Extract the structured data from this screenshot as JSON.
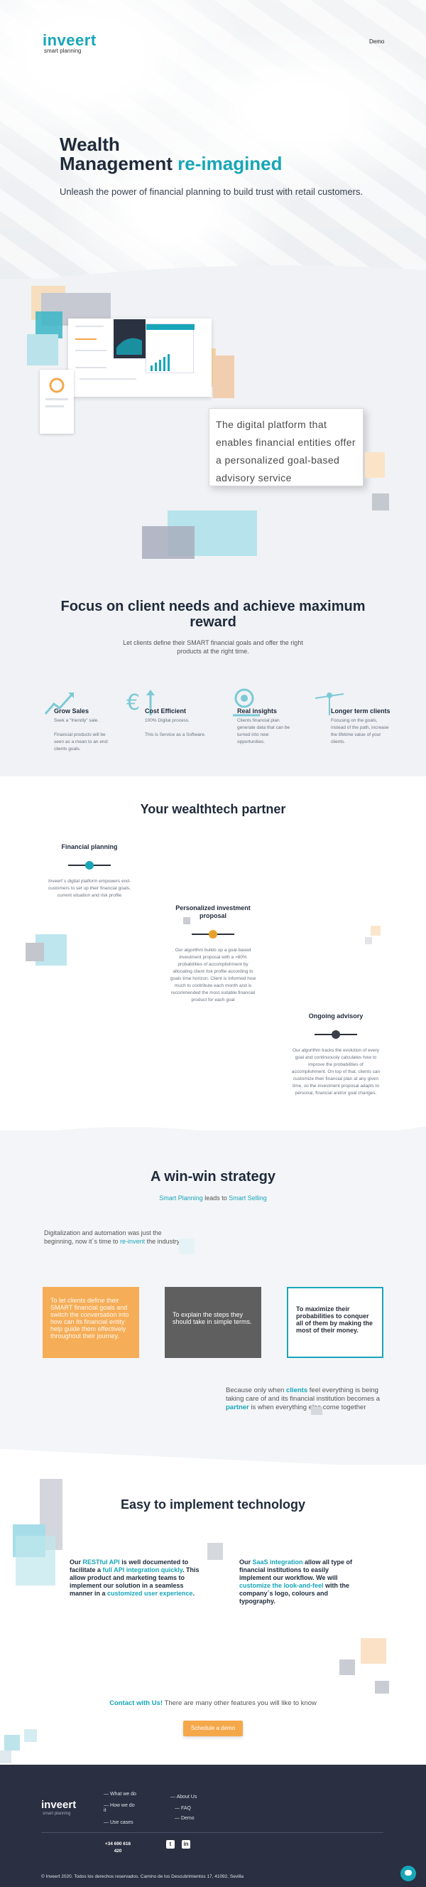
{
  "header": {
    "logo_word": "inveert",
    "logo_sub": "smart planning",
    "nav_demo": "Demo"
  },
  "hero": {
    "title_line1": "Wealth",
    "title_line2_a": "Management ",
    "title_line2_b": "re-imagined",
    "subtitle": "Unleash the power of financial planning to build trust with retail customers."
  },
  "platform": {
    "quote": "The digital platform that enables financial entities offer a personalized goal-based advisory service"
  },
  "focus": {
    "title": "Focus on client needs and achieve maximum reward",
    "subtitle": "Let clients define their SMART financial goals and offer the right products at the right time.",
    "features": [
      {
        "title": "Grow Sales",
        "lines": [
          "Seek a \"friendly\" sale.",
          "",
          "Financial products will be",
          "seen as a mean to an end:",
          "clients goals."
        ]
      },
      {
        "title": "Cost Efficient",
        "lines": [
          "100% Digital process.",
          "",
          "This is Service as a Software."
        ]
      },
      {
        "title": "Real insights",
        "lines": [
          "Clients financial plan",
          "generate data that can be",
          "turned into new",
          "opportunities."
        ]
      },
      {
        "title": "Longer term clients",
        "lines": [
          "Focusing on the goals,",
          "instead of the path, increase",
          "the lifetime value of your",
          "clients."
        ]
      }
    ]
  },
  "wealthtech": {
    "title": "Your wealthtech partner",
    "columns": [
      {
        "title": "Financial planning",
        "lines": [
          "Inveert´s digital platform empowers end-",
          "customers to set up their financial goals,",
          "current situation and risk profile"
        ]
      },
      {
        "title": "Personalized investment proposal",
        "lines": [
          "Our algorithm builds up a goal-based",
          "investment proposal with a >80%",
          "probabilities of accomplishment by",
          "allocating client risk profile according to",
          "goals time horizon. Client is informed how",
          "much to contribute each month and is",
          "recommended the most suitable financial",
          "product for each goal"
        ]
      },
      {
        "title": "Ongoing advisory",
        "lines": [
          "Our algorithm tracks the evolution of every",
          "goal and continuously calculates how to",
          "improve the probabilities of",
          "accomplishment. On top of that, clients can",
          "customize their financial plan at any given",
          "time, so the investment proposal adapts to",
          "personal, financial and/or goal changes."
        ]
      }
    ]
  },
  "winwin": {
    "title": "A win-win strategy",
    "sub_a": "Smart Planning",
    "sub_b": " leads to ",
    "sub_c": "Smart Selling",
    "intro_a": "Digitalization and automation was just the beginning, now it´s time to ",
    "intro_b": "re-invent",
    "intro_c": " the industry",
    "cards": [
      {
        "text": "To let clients define their SMART financial goals and switch the conversation into how can its financial entity help guide them effectively throughout their journey."
      },
      {
        "text": "To explain the steps they should take in simple terms."
      },
      {
        "text": "To maximize their probabilities to conquer all of them by making the most of their money."
      }
    ],
    "close_a": "Because only when ",
    "close_b": "clients",
    "close_c": " feel everything is being taking care of and its financial institution becomes a ",
    "close_d": "partner",
    "close_e": " is when everything else come together"
  },
  "tech": {
    "title": "Easy to implement technology",
    "left_a": "Our ",
    "left_b": "RESTful API",
    "left_c": " is well documented to facilitate a ",
    "left_d": "full API integration quickly",
    "left_e": ". This allow product and marketing teams to implement our solution in a seamless manner in a ",
    "left_f": "customized user experience",
    "left_g": ".",
    "right_a": "Our ",
    "right_b": "SaaS integration",
    "right_c": " allow all type of financial institutions to easily implement our workflow. We will ",
    "right_d": "customize the look-and-feel",
    "right_e": " with the company´s logo, colours and typography.",
    "contact_a": "Contact with Us!",
    "contact_b": " There are many other features you will like to know",
    "demo_button": "Schedule a demo"
  },
  "footer": {
    "logo_word": "inveert",
    "logo_sub": "smart planning",
    "links_col1": [
      "What we do",
      "How we do it",
      "Use cases"
    ],
    "links_col2": [
      "About Us",
      "FAQ",
      "Demo"
    ],
    "phone_line1": "+34 690 616",
    "phone_line2": "420",
    "social": [
      "twitter-icon",
      "linkedin-icon"
    ],
    "copyright": "© Inveert 2020. Todos los derechos reservados.  Camino de los Descubrimientos 17, 41092, Sevilla"
  },
  "colors": {
    "accent": "#17a6b8",
    "orange": "#f5a84a",
    "dark_card": "#5f5f5f",
    "footer_bg": "#2a2f41"
  }
}
